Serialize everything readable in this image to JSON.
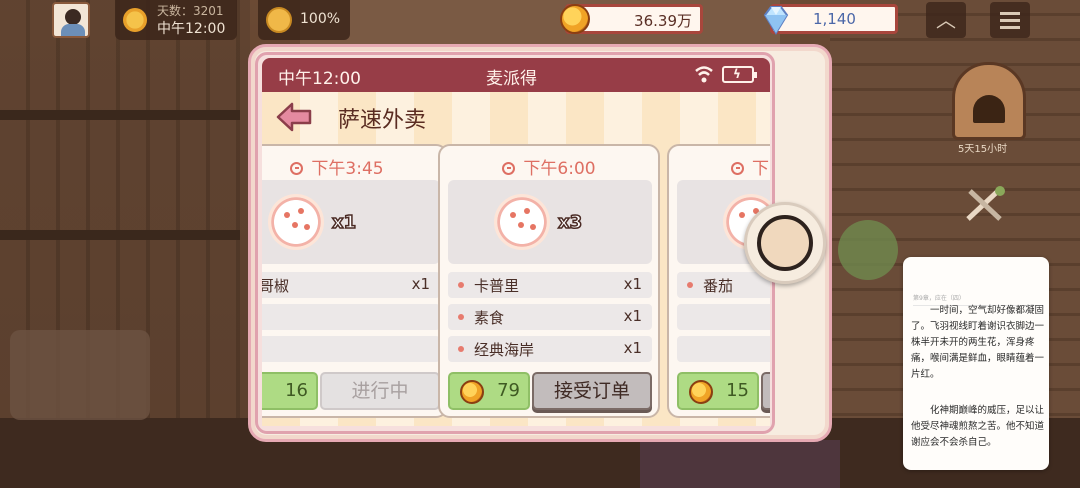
{
  "hud": {
    "day_label": "天数：3201",
    "time": "中午12:00",
    "mood_percent": "100%",
    "coins": "36.39万",
    "gems": "1,140",
    "oven_timer": "5天15小时"
  },
  "phone": {
    "status_time": "中午12:00",
    "app_name": "麦派得",
    "title": "萨速外卖"
  },
  "orders": [
    {
      "time": "下午3:45",
      "quantity": "x1",
      "ingredients": [
        {
          "name": "西哥椒",
          "qty": "x1"
        },
        {
          "name": "",
          "qty": ""
        },
        {
          "name": "",
          "qty": ""
        }
      ],
      "reward": "16",
      "button": "进行中",
      "state": "in-progress"
    },
    {
      "time": "下午6:00",
      "quantity": "x3",
      "ingredients": [
        {
          "name": "卡普里",
          "qty": "x1"
        },
        {
          "name": "素食",
          "qty": "x1"
        },
        {
          "name": "经典海岸",
          "qty": "x1"
        }
      ],
      "reward": "79",
      "button": "接受订单",
      "state": "available"
    },
    {
      "time": "下",
      "quantity": "",
      "ingredients": [
        {
          "name": "番茄",
          "qty": ""
        },
        {
          "name": "",
          "qty": ""
        },
        {
          "name": "",
          "qty": ""
        }
      ],
      "reward": "15",
      "button": "",
      "state": "available"
    }
  ],
  "novel": {
    "meta": "第9章，应在（四）",
    "paragraph1": "一时间，空气却好像都凝固了。飞羽视线盯着谢识衣脚边一株半开未开的两生花，浑身疼痛，喉间满是鲜血，眼睛蕴着一片红。",
    "paragraph2": "化神期巅峰的威压，足以让他受尽神魂煎熬之苦。他不知道谢应会不会杀自己。"
  },
  "colors": {
    "header_red": "#973d47",
    "accent_orange": "#de6f63",
    "reward_green": "#aedb84",
    "frame_pink": "#e6a9b3"
  }
}
